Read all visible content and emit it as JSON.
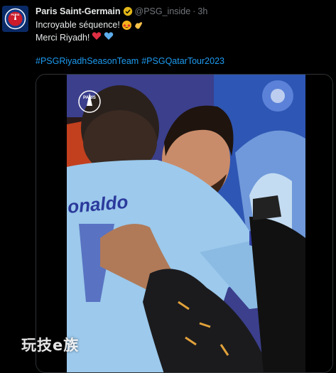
{
  "tweet": {
    "author_name": "Paris Saint-Germain",
    "handle": "@PSG_inside",
    "separator": "·",
    "time": "3h",
    "line1": "Incroyable séquence!",
    "line2": "Merci Riyadh!",
    "hashtags": [
      "#PSGRiyadhSeasonTeam",
      "#PSGQatarTour2023"
    ]
  },
  "avatar": {
    "text": "PARIS"
  },
  "media": {
    "jersey_text": "onaldo",
    "badge_text": "PARIS"
  },
  "watermark": "玩技e族",
  "icons": {
    "verified": "verified-badge-icon",
    "emoji1": "star-struck-emoji",
    "emoji2": "clapping-hands-emoji",
    "emoji3": "red-heart-emoji",
    "emoji4": "blue-heart-emoji"
  },
  "colors": {
    "background": "#000000",
    "link": "#1d9bf0",
    "muted": "#71767b",
    "text": "#e7e9ea",
    "psg_navy": "#0a2a66"
  }
}
